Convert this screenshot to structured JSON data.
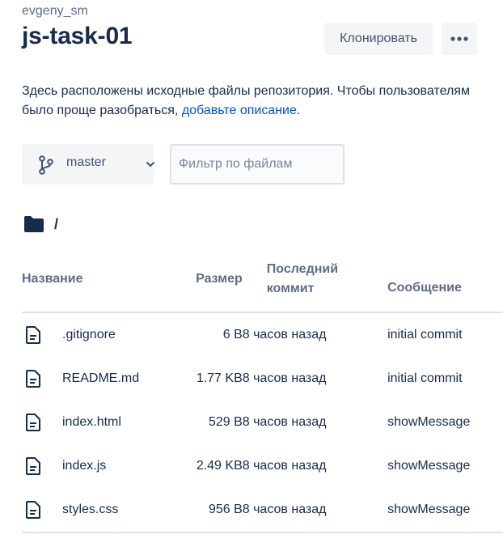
{
  "repo": {
    "owner": "evgeny_sm",
    "name": "js-task-01"
  },
  "actions": {
    "clone_label": "Клонировать",
    "more_icon": "more-horizontal-icon"
  },
  "description": {
    "text": "Здесь расположены исходные файлы репозитория. Чтобы пользователям было проще разобраться, ",
    "link_text": "добавьте описание",
    "tail": "."
  },
  "branch": {
    "icon": "branch-icon",
    "label": "master",
    "chevron_icon": "chevron-down-icon"
  },
  "filter": {
    "placeholder": "Фильтр по файлам",
    "value": ""
  },
  "path": {
    "icon": "folder-icon",
    "separator": "/"
  },
  "table": {
    "headers": {
      "name": "Название",
      "size": "Размер",
      "commit": "Последний коммит",
      "message": "Сообщение"
    },
    "rows": [
      {
        "name": ".gitignore",
        "size": "6 B",
        "commit": "8 часов назад",
        "message": "initial commit"
      },
      {
        "name": "README.md",
        "size": "1.77 KB",
        "commit": "8 часов назад",
        "message": "initial commit"
      },
      {
        "name": "index.html",
        "size": "529 B",
        "commit": "8 часов назад",
        "message": "showMessage"
      },
      {
        "name": "index.js",
        "size": "2.49 KB",
        "commit": "8 часов назад",
        "message": "showMessage"
      },
      {
        "name": "styles.css",
        "size": "956 B",
        "commit": "8 часов назад",
        "message": "showMessage"
      }
    ]
  },
  "colors": {
    "text": "#172b4d",
    "subtle": "#5e6c84",
    "link": "#0052cc",
    "button_bg": "#f4f5f7"
  }
}
